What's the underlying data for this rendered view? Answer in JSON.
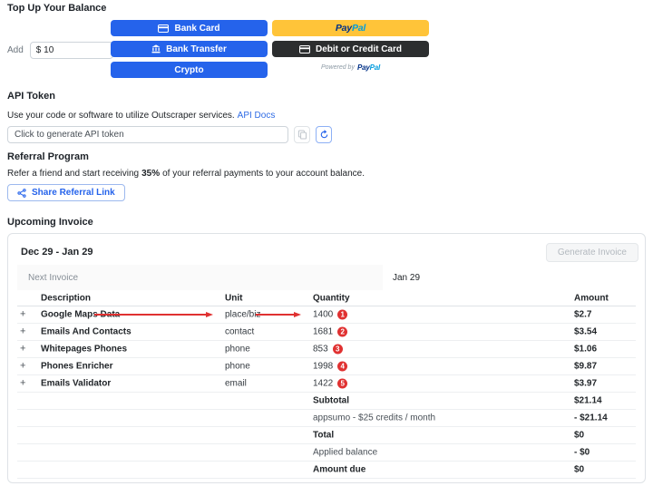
{
  "topup": {
    "title": "Top Up Your Balance",
    "add_label": "Add",
    "amount_value": "$ 10",
    "buttons": {
      "bank_card": "Bank Card",
      "bank_transfer": "Bank Transfer",
      "crypto": "Crypto",
      "debit_credit": "Debit or Credit Card"
    },
    "paypal": {
      "pay": "Pay",
      "pal": "Pal",
      "powered_by": "Powered by"
    }
  },
  "api_token": {
    "title": "API Token",
    "description": "Use your code or software to utilize Outscraper services.",
    "docs_link": "API Docs",
    "input_value": "Click to generate API token"
  },
  "referral": {
    "title": "Referral Program",
    "text_before": "Refer a friend and start receiving",
    "percent": "35%",
    "text_after": "of your referral payments to your account balance.",
    "share_button": "Share Referral Link"
  },
  "invoice": {
    "title": "Upcoming Invoice",
    "period": "Dec 29 - Jan 29",
    "generate_button": "Generate Invoice",
    "next_invoice_label": "Next Invoice",
    "next_invoice_date": "Jan 29",
    "expander": "+",
    "columns": {
      "description": "Description",
      "unit": "Unit",
      "quantity": "Quantity",
      "amount": "Amount"
    },
    "rows": [
      {
        "description": "Google Maps Data",
        "unit": "place/biz",
        "quantity": "1400",
        "badge": "1",
        "amount": "$2.7"
      },
      {
        "description": "Emails And Contacts",
        "unit": "contact",
        "quantity": "1681",
        "badge": "2",
        "amount": "$3.54"
      },
      {
        "description": "Whitepages Phones",
        "unit": "phone",
        "quantity": "853",
        "badge": "3",
        "amount": "$1.06"
      },
      {
        "description": "Phones Enricher",
        "unit": "phone",
        "quantity": "1998",
        "badge": "4",
        "amount": "$9.87"
      },
      {
        "description": "Emails Validator",
        "unit": "email",
        "quantity": "1422",
        "badge": "5",
        "amount": "$3.97"
      }
    ],
    "summary": [
      {
        "label": "Subtotal",
        "amount": "$21.14",
        "bold": true
      },
      {
        "label": "appsumo - $25 credits / month",
        "amount": "- $21.14",
        "bold": false
      },
      {
        "label": "Total",
        "amount": "$0",
        "bold": true
      },
      {
        "label": "Applied balance",
        "amount": "- $0",
        "bold": false
      },
      {
        "label": "Amount due",
        "amount": "$0",
        "bold": true
      }
    ]
  },
  "colors": {
    "primary_blue": "#2563eb",
    "paypal_yellow": "#ffc439",
    "dark_button": "#2c2e2f",
    "annotation_red": "#e03131",
    "link_blue": "#2e6be5"
  },
  "icons": {
    "bank_card": "card-icon",
    "bank_transfer": "bank-icon",
    "debit_credit": "card-icon",
    "copy": "copy-icon",
    "refresh": "refresh-icon",
    "share": "share-icon",
    "expand": "plus-icon"
  }
}
